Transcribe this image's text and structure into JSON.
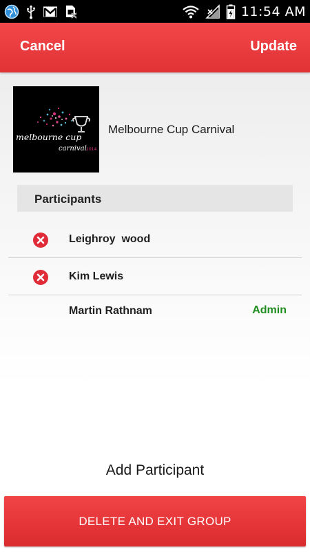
{
  "status_bar": {
    "time": "11:54 AM",
    "battery_level": "76",
    "icons": [
      "globe-icon",
      "usb-icon",
      "gmail-icon",
      "no-sim-icon",
      "wifi-icon",
      "no-signal-icon",
      "battery-charging-icon"
    ]
  },
  "action_bar": {
    "cancel_label": "Cancel",
    "update_label": "Update",
    "color": "#e8393c"
  },
  "group": {
    "name": "Melbourne Cup Carnival",
    "image_text": {
      "line1": "melbourne cup",
      "line2": "carnival",
      "year": "2014"
    }
  },
  "participants": {
    "header": "Participants",
    "items": [
      {
        "name": "Leighroy  wood",
        "removable": true,
        "remove_icon": "remove-circle-icon"
      },
      {
        "name": "Kim Lewis",
        "removable": true,
        "remove_icon": "remove-circle-icon"
      },
      {
        "name": "Martin Rathnam",
        "removable": false,
        "role": "Admin"
      }
    ]
  },
  "footer": {
    "add_participant_label": "Add Participant",
    "delete_exit_label": "DELETE AND EXIT GROUP"
  },
  "colors": {
    "accent_red": "#e8393c",
    "admin_green": "#1f8c1f",
    "remove_red": "#e02b38"
  }
}
